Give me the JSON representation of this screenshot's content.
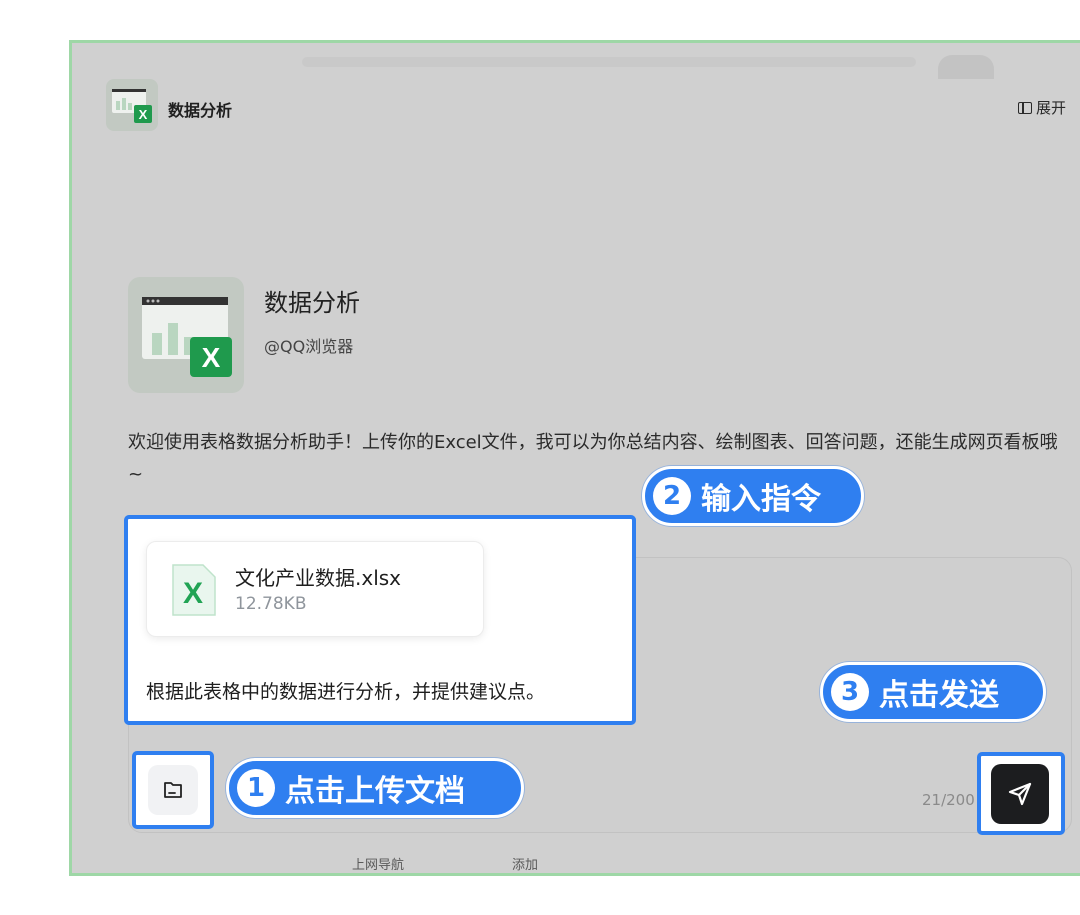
{
  "header": {
    "app_name": "数据分析",
    "expand_label": "展开"
  },
  "app": {
    "title": "数据分析",
    "author": "@QQ浏览器",
    "welcome": "欢迎使用表格数据分析助手！上传你的Excel文件，我可以为你总结内容、绘制图表、回答问题，还能生成网页看板哦 ~"
  },
  "composer": {
    "file": {
      "name": "文化产业数据.xlsx",
      "size": "12.78KB"
    },
    "prompt": "根据此表格中的数据进行分析，并提供建议点。",
    "counter": "21/200"
  },
  "callouts": [
    {
      "num": "1",
      "label": "点击上传文档"
    },
    {
      "num": "2",
      "label": "输入指令"
    },
    {
      "num": "3",
      "label": "点击发送"
    }
  ],
  "footer": {
    "nav": "上网导航",
    "add": "添加"
  },
  "colors": {
    "accent": "#2f7ff0",
    "excel": "#21a354",
    "overlay": "#d0d0d0",
    "frame": "#9ed7a6"
  }
}
